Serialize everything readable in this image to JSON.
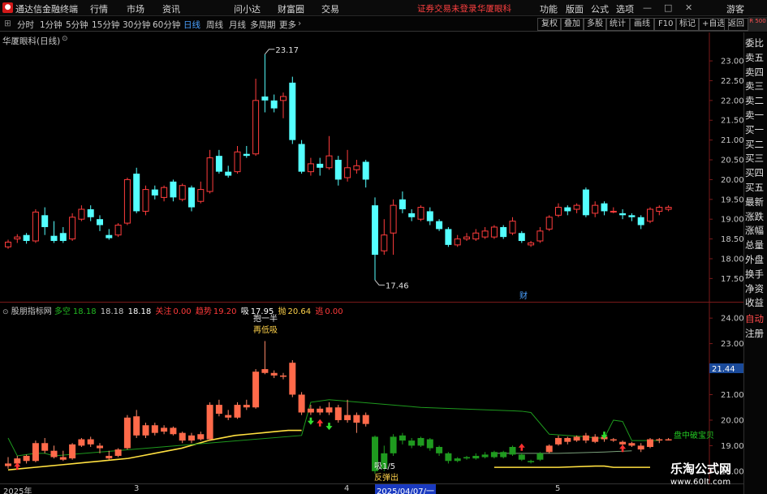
{
  "titlebar": {
    "app_name": "通达信金融终端",
    "menus": [
      "行情",
      "市场",
      "资讯",
      "问小达",
      "财富圈",
      "交易"
    ],
    "status_notice": "证券交易未登录",
    "stock_name": "华厦眼科",
    "right_menus": [
      "功能",
      "版面",
      "公式",
      "选项"
    ],
    "guest": "游客"
  },
  "toolbar": {
    "periods": [
      "分时",
      "1分钟",
      "5分钟",
      "15分钟",
      "30分钟",
      "60分钟",
      "日线",
      "周线",
      "月线",
      "多周期",
      "更多"
    ],
    "selected_period": "日线",
    "right_buttons": [
      "复权",
      "叠加",
      "多股",
      "统计",
      "画线",
      "F10",
      "标记",
      "+自选",
      "返回"
    ],
    "corner_badge": "R 500"
  },
  "right_panel": {
    "items": [
      "委比",
      "卖五",
      "卖四",
      "卖三",
      "卖二",
      "卖一",
      "买一",
      "买二",
      "买三",
      "买四",
      "买五",
      "最新",
      "涨跌",
      "涨幅",
      "总量",
      "外盘",
      "换手",
      "净资",
      "收益",
      "自动",
      "注册"
    ]
  },
  "main_chart": {
    "title": "华厦眼科(日线)",
    "high_label": "23.17",
    "low_label": "17.46",
    "event_tag": "财",
    "price_axis": [
      "23.00",
      "22.50",
      "22.00",
      "21.50",
      "21.00",
      "20.50",
      "20.00",
      "19.50",
      "19.00",
      "18.50",
      "18.00",
      "17.50"
    ],
    "price_min": 17.2,
    "price_max": 23.35
  },
  "indicator": {
    "name": "股朋指标网",
    "stats": [
      {
        "label": "多空",
        "value": "18.18",
        "color": "#22b822"
      },
      {
        "label": "",
        "value": "18.18",
        "color": "#c8c8c8"
      },
      {
        "label": "",
        "value": "18.18",
        "color": "#ffffff"
      },
      {
        "label": "关注",
        "value": "0.00",
        "color": "#ff3a3a"
      },
      {
        "label": "趋势",
        "value": "19.20",
        "color": "#ff3a3a"
      },
      {
        "label": "吸",
        "value": "17.95",
        "color": "#ffffff"
      },
      {
        "label": "抛",
        "value": "20.64",
        "color": "#ffd24a"
      },
      {
        "label": "逃",
        "value": "0.00",
        "color": "#ff3a3a"
      }
    ],
    "axis": [
      "24.00",
      "23.00",
      "22.00",
      "21.00",
      "20.00",
      "19.00",
      "18.00"
    ],
    "axis_min": 17.55,
    "axis_max": 24.45,
    "price_tag": "21.44",
    "annotations": {
      "top_cut": "抱一半",
      "relow": "再低吸",
      "xi": "吸1/5",
      "rebound": "反弹出",
      "panzhong": "盘中破宝贝"
    }
  },
  "date_axis": {
    "labels": [
      "2025年",
      "3",
      "4",
      "2025/04/07/一",
      "5"
    ]
  },
  "watermark": {
    "name": "乐淘公式网",
    "url": "www.60lt.com"
  },
  "chart_data": {
    "type": "candlestick",
    "title": "华厦眼科(日线)",
    "ylim": [
      17.2,
      23.35
    ],
    "candles": [
      [
        18.3,
        18.42,
        18.25,
        18.48
      ],
      [
        18.5,
        18.55,
        18.4,
        18.62
      ],
      [
        18.6,
        18.45,
        18.38,
        18.65
      ],
      [
        18.45,
        19.18,
        18.4,
        19.25
      ],
      [
        19.1,
        18.8,
        18.6,
        19.3
      ],
      [
        18.58,
        18.45,
        18.4,
        18.95
      ],
      [
        18.65,
        18.45,
        18.4,
        18.8
      ],
      [
        18.5,
        19.05,
        18.45,
        19.15
      ],
      [
        19.0,
        19.25,
        18.95,
        19.35
      ],
      [
        19.25,
        19.05,
        18.95,
        19.35
      ],
      [
        19.0,
        18.85,
        18.7,
        19.1
      ],
      [
        18.6,
        18.52,
        18.48,
        18.75
      ],
      [
        18.6,
        18.85,
        18.55,
        18.9
      ],
      [
        18.9,
        20.0,
        18.85,
        20.05
      ],
      [
        20.15,
        19.2,
        19.15,
        20.3
      ],
      [
        19.2,
        19.75,
        19.1,
        19.85
      ],
      [
        19.75,
        19.6,
        19.5,
        19.85
      ],
      [
        19.55,
        19.8,
        19.45,
        19.85
      ],
      [
        19.95,
        19.55,
        19.45,
        20.0
      ],
      [
        19.5,
        19.85,
        19.45,
        19.9
      ],
      [
        19.8,
        19.3,
        19.2,
        19.85
      ],
      [
        19.45,
        19.75,
        19.4,
        19.95
      ],
      [
        19.7,
        20.55,
        19.65,
        20.75
      ],
      [
        20.6,
        20.2,
        20.15,
        20.75
      ],
      [
        20.2,
        20.1,
        20.05,
        20.35
      ],
      [
        20.2,
        20.7,
        20.15,
        20.85
      ],
      [
        20.65,
        20.6,
        20.55,
        20.85
      ],
      [
        20.65,
        22.0,
        20.6,
        22.55
      ],
      [
        22.1,
        22.0,
        21.7,
        23.17
      ],
      [
        22.0,
        21.8,
        21.7,
        22.15
      ],
      [
        22.0,
        22.1,
        21.55,
        22.2
      ],
      [
        22.45,
        21.0,
        20.9,
        22.6
      ],
      [
        20.9,
        20.2,
        20.15,
        21.0
      ],
      [
        20.2,
        20.4,
        20.1,
        20.55
      ],
      [
        20.4,
        20.3,
        20.1,
        20.55
      ],
      [
        20.3,
        20.6,
        20.25,
        21.1
      ],
      [
        20.5,
        20.0,
        19.85,
        20.6
      ],
      [
        20.05,
        20.3,
        19.95,
        20.75
      ],
      [
        20.25,
        20.35,
        20.15,
        20.5
      ],
      [
        20.45,
        20.0,
        19.8,
        20.5
      ],
      [
        19.35,
        18.1,
        17.46,
        19.55
      ],
      [
        18.2,
        18.6,
        18.1,
        19.0
      ],
      [
        18.65,
        19.35,
        18.1,
        19.5
      ],
      [
        19.5,
        19.25,
        19.15,
        19.7
      ],
      [
        19.15,
        19.05,
        18.95,
        19.25
      ],
      [
        19.0,
        19.3,
        18.95,
        19.35
      ],
      [
        19.2,
        18.95,
        18.85,
        19.3
      ],
      [
        18.95,
        18.75,
        18.7,
        19.0
      ],
      [
        18.75,
        18.35,
        18.3,
        18.8
      ],
      [
        18.35,
        18.5,
        18.3,
        18.6
      ],
      [
        18.5,
        18.55,
        18.45,
        18.65
      ],
      [
        18.5,
        18.65,
        18.45,
        18.75
      ],
      [
        18.55,
        18.7,
        18.5,
        18.8
      ],
      [
        18.55,
        18.8,
        18.5,
        18.85
      ],
      [
        18.8,
        18.55,
        18.5,
        18.85
      ],
      [
        18.65,
        18.95,
        18.6,
        19.05
      ],
      [
        18.65,
        18.45,
        18.4,
        18.7
      ],
      [
        18.35,
        18.4,
        18.3,
        18.45
      ],
      [
        18.45,
        18.7,
        18.4,
        18.8
      ],
      [
        18.75,
        19.05,
        18.7,
        19.1
      ],
      [
        19.1,
        19.3,
        19.05,
        19.4
      ],
      [
        19.3,
        19.2,
        19.1,
        19.35
      ],
      [
        19.25,
        19.35,
        19.15,
        19.4
      ],
      [
        19.75,
        19.1,
        19.05,
        19.8
      ],
      [
        19.15,
        19.35,
        19.05,
        19.45
      ],
      [
        19.4,
        19.2,
        19.1,
        19.45
      ],
      [
        19.2,
        19.2,
        19.15,
        19.3
      ],
      [
        19.15,
        19.1,
        19.0,
        19.25
      ],
      [
        19.1,
        19.05,
        18.95,
        19.15
      ],
      [
        19.05,
        18.85,
        18.75,
        19.1
      ],
      [
        18.95,
        19.25,
        18.9,
        19.3
      ],
      [
        19.2,
        19.3,
        19.1,
        19.35
      ],
      [
        19.25,
        19.3,
        19.2,
        19.35
      ]
    ],
    "ind_candles": [
      [
        18.2,
        18.3,
        18.1,
        18.55
      ],
      [
        18.3,
        18.5,
        18.2,
        18.6
      ],
      [
        18.6,
        18.4,
        18.3,
        18.65
      ],
      [
        18.4,
        19.1,
        18.35,
        19.2
      ],
      [
        19.1,
        18.8,
        18.7,
        19.3
      ],
      [
        18.8,
        18.55,
        18.5,
        19.0
      ],
      [
        18.55,
        18.45,
        18.4,
        18.8
      ],
      [
        18.5,
        19.05,
        18.45,
        19.1
      ],
      [
        19.0,
        19.25,
        18.95,
        19.3
      ],
      [
        19.25,
        19.05,
        18.95,
        19.35
      ],
      [
        19.0,
        18.9,
        18.7,
        19.1
      ],
      [
        18.6,
        18.5,
        18.45,
        18.8
      ],
      [
        18.6,
        18.85,
        18.55,
        18.9
      ],
      [
        18.9,
        20.1,
        18.85,
        20.2
      ],
      [
        20.15,
        19.4,
        19.3,
        20.4
      ],
      [
        19.4,
        19.8,
        19.3,
        19.9
      ],
      [
        19.8,
        19.5,
        19.4,
        19.9
      ],
      [
        19.55,
        19.7,
        19.45,
        19.8
      ],
      [
        19.7,
        19.45,
        19.4,
        19.75
      ],
      [
        19.5,
        19.2,
        19.1,
        19.55
      ],
      [
        19.2,
        19.4,
        19.1,
        19.5
      ],
      [
        19.45,
        19.25,
        19.2,
        19.55
      ],
      [
        19.25,
        20.6,
        19.2,
        20.7
      ],
      [
        20.6,
        20.25,
        20.15,
        20.8
      ],
      [
        20.2,
        20.1,
        20.0,
        20.4
      ],
      [
        20.1,
        20.6,
        20.05,
        20.7
      ],
      [
        20.6,
        20.5,
        20.4,
        20.8
      ],
      [
        20.5,
        21.9,
        20.45,
        22.0
      ],
      [
        22.0,
        21.85,
        21.8,
        23.1
      ],
      [
        21.85,
        21.75,
        21.65,
        21.95
      ],
      [
        21.75,
        21.7,
        21.6,
        21.85
      ],
      [
        22.25,
        21.0,
        20.9,
        22.35
      ],
      [
        21.0,
        20.3,
        20.2,
        21.1
      ],
      [
        20.3,
        20.45,
        20.2,
        20.6
      ],
      [
        20.45,
        20.3,
        20.2,
        20.55
      ],
      [
        20.3,
        20.5,
        20.2,
        20.7
      ],
      [
        20.5,
        20.0,
        19.9,
        20.6
      ],
      [
        20.0,
        20.2,
        19.9,
        20.8
      ],
      [
        20.2,
        19.9,
        19.5,
        20.3
      ],
      [
        20.2,
        19.85,
        19.75,
        20.3
      ],
      [
        19.35,
        18.0,
        17.9,
        19.4
      ],
      [
        18.1,
        18.7,
        18.0,
        19.0
      ],
      [
        18.7,
        19.35,
        18.6,
        19.45
      ],
      [
        19.4,
        19.2,
        19.05,
        19.5
      ],
      [
        19.2,
        19.0,
        18.9,
        19.3
      ],
      [
        19.0,
        19.3,
        18.95,
        19.35
      ],
      [
        19.25,
        18.9,
        18.8,
        19.3
      ],
      [
        18.95,
        18.7,
        18.6,
        19.0
      ],
      [
        18.7,
        18.4,
        18.3,
        18.75
      ],
      [
        18.4,
        18.5,
        18.35,
        18.55
      ],
      [
        18.5,
        18.55,
        18.45,
        18.6
      ],
      [
        18.5,
        18.6,
        18.45,
        18.7
      ],
      [
        18.55,
        18.65,
        18.5,
        18.75
      ],
      [
        18.55,
        18.75,
        18.5,
        18.8
      ],
      [
        18.75,
        18.55,
        18.5,
        18.8
      ],
      [
        18.65,
        18.95,
        18.6,
        19.0
      ],
      [
        18.65,
        18.45,
        18.4,
        18.7
      ],
      [
        18.4,
        18.35,
        18.3,
        18.45
      ],
      [
        18.45,
        18.7,
        18.4,
        18.75
      ],
      [
        18.75,
        19.0,
        18.7,
        19.05
      ],
      [
        19.05,
        19.3,
        19.0,
        19.4
      ],
      [
        19.3,
        19.15,
        19.05,
        19.35
      ],
      [
        19.2,
        19.35,
        19.15,
        19.4
      ],
      [
        19.4,
        19.2,
        19.1,
        19.5
      ],
      [
        19.15,
        19.35,
        19.1,
        19.45
      ],
      [
        19.35,
        19.25,
        19.15,
        19.4
      ],
      [
        19.25,
        19.2,
        19.15,
        19.3
      ],
      [
        19.15,
        19.05,
        19.0,
        19.2
      ],
      [
        19.1,
        19.0,
        18.95,
        19.15
      ],
      [
        19.0,
        18.85,
        18.75,
        19.1
      ],
      [
        18.95,
        19.25,
        18.9,
        19.3
      ],
      [
        19.2,
        19.25,
        19.1,
        19.3
      ],
      [
        19.25,
        19.25,
        19.2,
        19.3
      ]
    ],
    "green_index_range": [
      40,
      58
    ],
    "yellow_line": [
      18.05,
      18.1,
      18.15,
      18.2,
      18.25,
      18.3,
      18.35,
      18.4,
      18.45,
      18.5,
      18.6,
      18.7,
      18.8,
      18.9,
      19.05,
      19.2,
      19.3,
      19.4,
      19.45,
      19.5,
      19.55,
      19.6,
      19.6
    ],
    "green_line": [
      [
        0,
        19.3
      ],
      [
        1,
        18.6
      ],
      [
        2,
        18.65
      ],
      [
        3,
        18.7
      ],
      [
        4,
        18.7
      ],
      [
        5,
        18.6
      ],
      [
        32,
        19.4
      ],
      [
        33,
        20.7
      ],
      [
        35,
        20.8
      ],
      [
        45,
        20.5
      ],
      [
        56,
        20.35
      ],
      [
        57,
        20.3
      ],
      [
        59,
        19.45
      ],
      [
        61,
        19.4
      ],
      [
        63,
        19.35
      ],
      [
        64,
        19.3
      ],
      [
        65,
        19.3
      ],
      [
        66,
        20.0
      ],
      [
        67,
        19.95
      ],
      [
        68,
        19.2
      ],
      [
        71,
        19.2
      ]
    ],
    "pale_line": [
      [
        53,
        18.7
      ],
      [
        60,
        18.7
      ],
      [
        65,
        18.75
      ],
      [
        68,
        18.8
      ]
    ],
    "short_yellow": [
      [
        53,
        18.15
      ],
      [
        60,
        18.15
      ],
      [
        64,
        18.2
      ],
      [
        65,
        18.2
      ],
      [
        66,
        18.15
      ],
      [
        70,
        18.15
      ]
    ],
    "arrows": [
      {
        "i": 1,
        "dir": "up",
        "y": 18.05
      },
      {
        "i": 33,
        "dir": "down",
        "y": 20.1
      },
      {
        "i": 34,
        "dir": "up",
        "y": 19.75
      },
      {
        "i": 35,
        "dir": "down",
        "y": 19.9
      },
      {
        "i": 56,
        "dir": "up",
        "y": 18.8
      },
      {
        "i": 65,
        "dir": "down",
        "y": 19.55
      },
      {
        "i": 67,
        "dir": "up",
        "y": 18.75
      }
    ]
  }
}
